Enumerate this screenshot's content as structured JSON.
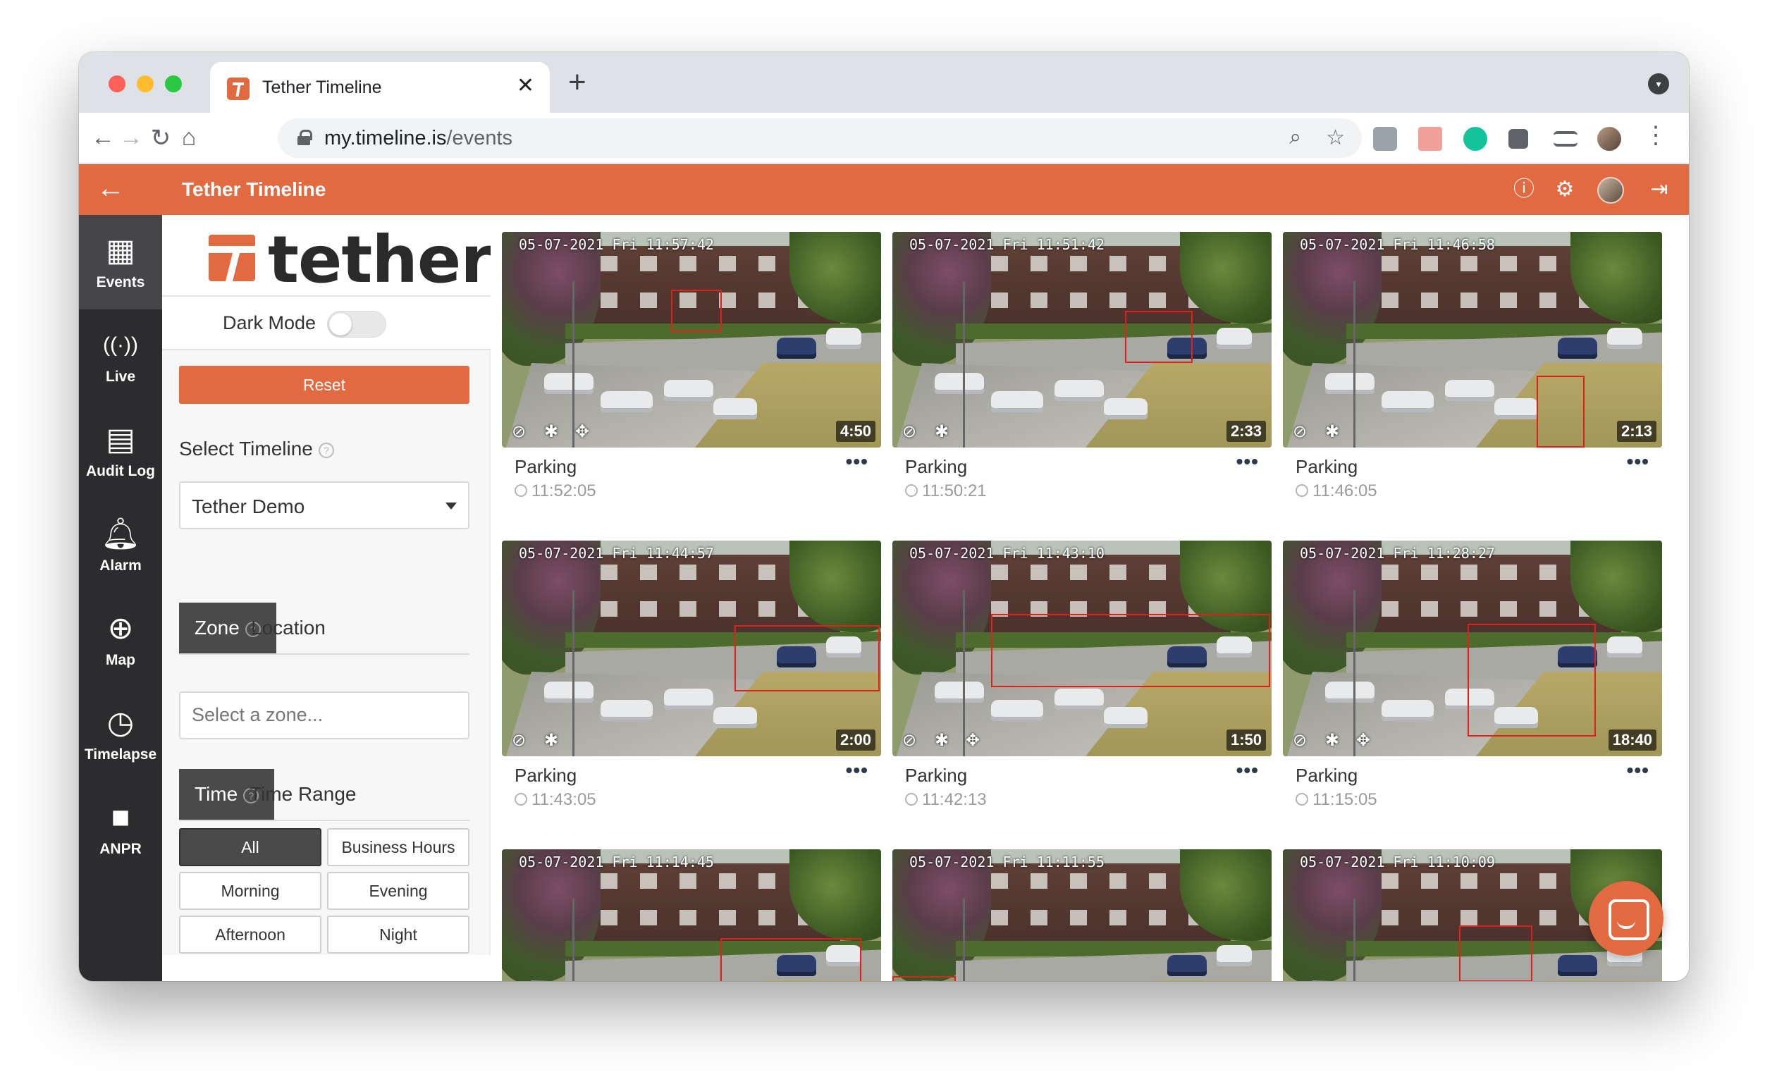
{
  "browser": {
    "tab_title": "Tether Timeline",
    "tab_close": "✕",
    "new_tab": "+",
    "url_host": "my.timeline.is",
    "url_path": "/events"
  },
  "app": {
    "title": "Tether Timeline",
    "brand_word": "tether",
    "accent": "#e26a40"
  },
  "nav": [
    {
      "label": "Events",
      "icon": "calendar-icon",
      "glyph": "▦",
      "active": true
    },
    {
      "label": "Live",
      "icon": "broadcast-icon",
      "glyph": "((·))",
      "active": false
    },
    {
      "label": "Audit Log",
      "icon": "document-icon",
      "glyph": "▤",
      "active": false
    },
    {
      "label": "Alarm",
      "icon": "bell-icon",
      "glyph": "♫",
      "active": false
    },
    {
      "label": "Map",
      "icon": "globe-icon",
      "glyph": "⊕",
      "active": false
    },
    {
      "label": "Timelapse",
      "icon": "stopwatch-icon",
      "glyph": "◷",
      "active": false
    },
    {
      "label": "ANPR",
      "icon": "video-camera-icon",
      "glyph": "■",
      "active": false
    }
  ],
  "filters": {
    "dark_mode_label": "Dark Mode",
    "dark_mode_on": false,
    "reset_label": "Reset",
    "select_timeline_label": "Select Timeline",
    "timeline_value": "Tether Demo",
    "zone_tab": "Zone",
    "location_tab": "Location",
    "zone_placeholder": "Select a zone...",
    "time_tab": "Time",
    "time_range_tab": "Time Range",
    "time_buttons": [
      "All",
      "Business Hours",
      "Morning",
      "Evening",
      "Afternoon",
      "Night"
    ],
    "help_glyph": "?"
  },
  "events": [
    {
      "stamp": "05-07-2021 Fri 11:57:42",
      "duration": "4:50",
      "title": "Parking",
      "time": "11:52:05"
    },
    {
      "stamp": "05-07-2021 Fri 11:51:42",
      "duration": "2:33",
      "title": "Parking",
      "time": "11:50:21"
    },
    {
      "stamp": "05-07-2021 Fri 11:46:58",
      "duration": "2:13",
      "title": "Parking",
      "time": "11:46:05"
    },
    {
      "stamp": "05-07-2021 Fri 11:44:57",
      "duration": "2:00",
      "title": "Parking",
      "time": "11:43:05"
    },
    {
      "stamp": "05-07-2021 Fri 11:43:10",
      "duration": "1:50",
      "title": "Parking",
      "time": "11:42:13"
    },
    {
      "stamp": "05-07-2021 Fri 11:28:27",
      "duration": "18:40",
      "title": "Parking",
      "time": "11:15:05"
    },
    {
      "stamp": "05-07-2021 Fri 11:14:45",
      "duration": "",
      "title": "",
      "time": ""
    },
    {
      "stamp": "05-07-2021 Fri 11:11:55",
      "duration": "",
      "title": "",
      "time": ""
    },
    {
      "stamp": "05-07-2021 Fri 11:10:09",
      "duration": "",
      "title": "",
      "time": ""
    }
  ],
  "more_glyph": "•••"
}
